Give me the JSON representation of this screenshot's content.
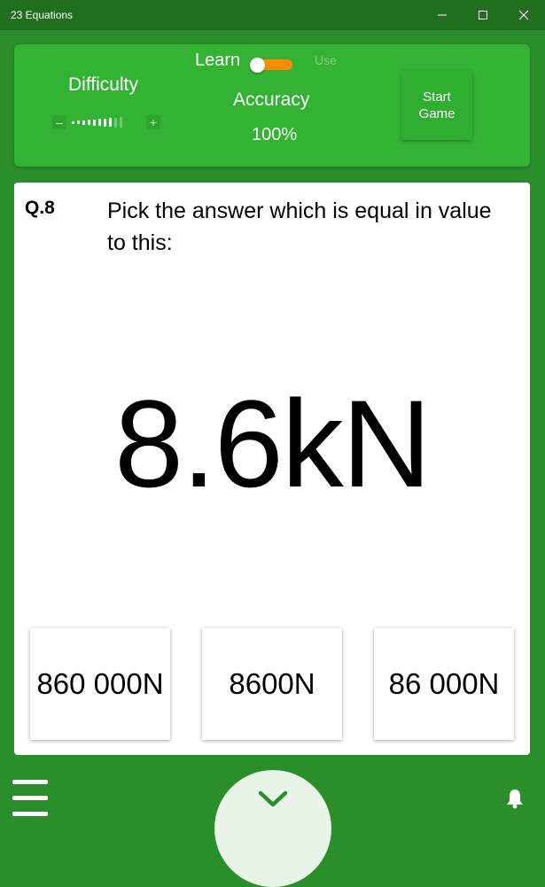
{
  "window": {
    "title": "23 Equations",
    "controls": [
      "minimize-icon",
      "maximize-icon",
      "close-icon"
    ]
  },
  "top_panel": {
    "difficulty_label": "Difficulty",
    "difficulty_slider": {
      "minus": "–",
      "plus": "+",
      "level_fraction": 0.8
    },
    "mode_toggle": {
      "left_label": "Learn",
      "right_label": "Use",
      "selected": "Learn"
    },
    "accuracy_label": "Accuracy",
    "accuracy_value": "100%",
    "start_button": {
      "line1": "Start",
      "line2": "Game"
    }
  },
  "question": {
    "number": "Q.8",
    "prompt": "Pick the answer which is equal in value to this:",
    "value": "8.6kN",
    "answers": [
      "860 000N",
      "8600N",
      "86 000N"
    ]
  },
  "bottom_bar": {
    "icons": [
      "hamburger-menu-icon",
      "chevron-down-icon",
      "bell-icon"
    ]
  },
  "colors": {
    "background": "#2a8e2a",
    "panel": "#33b233",
    "toggle_track": "#ff8c00",
    "card": "#ffffff"
  }
}
